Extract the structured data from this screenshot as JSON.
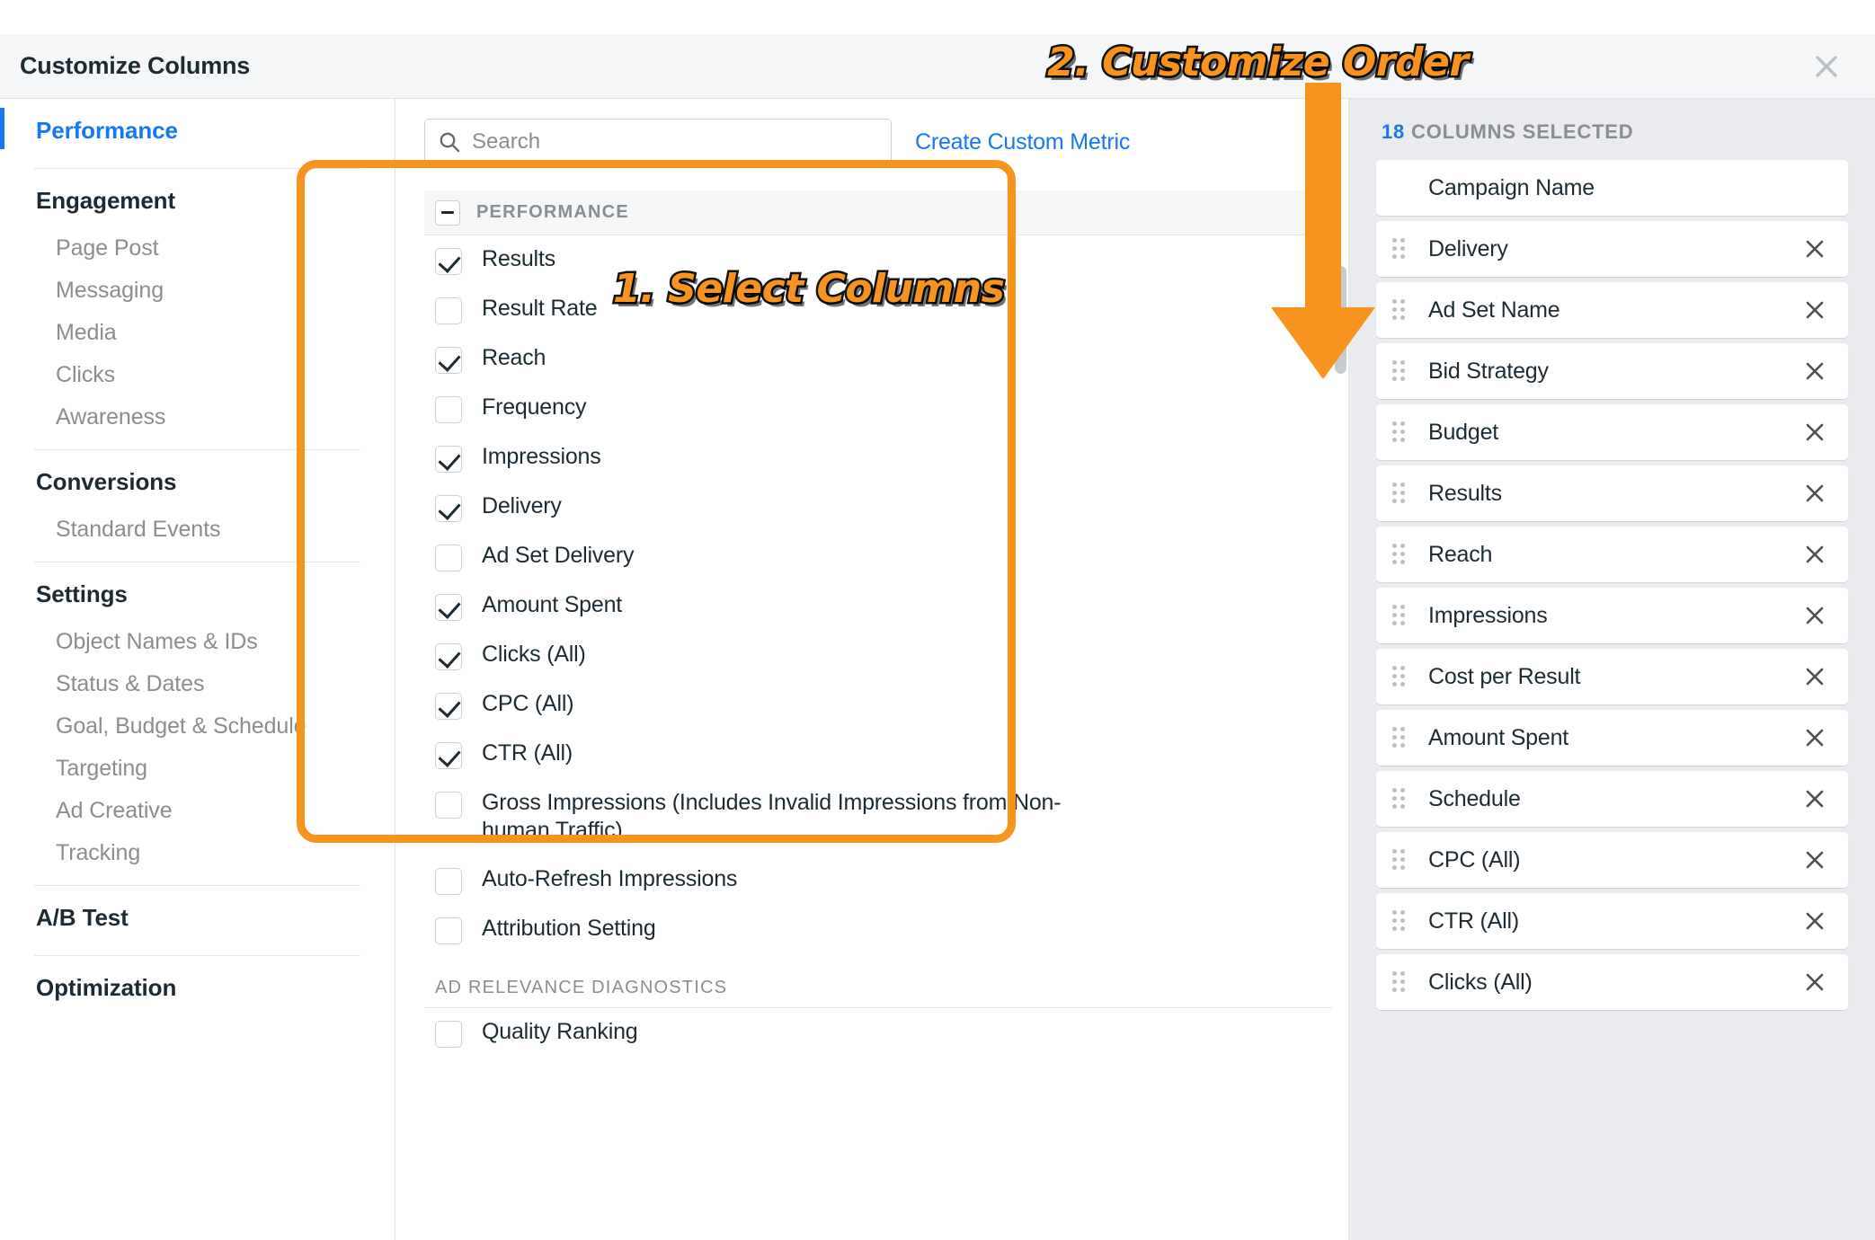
{
  "dialog": {
    "title": "Customize Columns",
    "close_icon": "close-icon"
  },
  "annotations": {
    "step1": "1. Select Columns",
    "step2": "2. Customize Order",
    "accent_color": "#F7931E",
    "outline_color": "#111111"
  },
  "sidebar": {
    "groups": [
      {
        "head": "Performance",
        "active": true,
        "items": []
      },
      {
        "head": "Engagement",
        "active": false,
        "items": [
          "Page Post",
          "Messaging",
          "Media",
          "Clicks",
          "Awareness"
        ]
      },
      {
        "head": "Conversions",
        "active": false,
        "items": [
          "Standard Events"
        ]
      },
      {
        "head": "Settings",
        "active": false,
        "items": [
          "Object Names & IDs",
          "Status & Dates",
          "Goal, Budget & Schedule",
          "Targeting",
          "Ad Creative",
          "Tracking"
        ]
      },
      {
        "head": "A/B Test",
        "active": false,
        "items": []
      },
      {
        "head": "Optimization",
        "active": false,
        "items": []
      }
    ]
  },
  "search": {
    "placeholder": "Search",
    "value": "",
    "icon": "search-icon"
  },
  "create_custom_metric_label": "Create Custom Metric",
  "sections": [
    {
      "title": "PERFORMANCE",
      "collapsed": false,
      "options": [
        {
          "label": "Results",
          "checked": true
        },
        {
          "label": "Result Rate",
          "checked": false
        },
        {
          "label": "Reach",
          "checked": true
        },
        {
          "label": "Frequency",
          "checked": false
        },
        {
          "label": "Impressions",
          "checked": true
        },
        {
          "label": "Delivery",
          "checked": true
        },
        {
          "label": "Ad Set Delivery",
          "checked": false
        },
        {
          "label": "Amount Spent",
          "checked": true
        },
        {
          "label": "Clicks (All)",
          "checked": true
        },
        {
          "label": "CPC (All)",
          "checked": true
        },
        {
          "label": "CTR (All)",
          "checked": true
        },
        {
          "label": "Gross Impressions (Includes Invalid Impressions from Non-human Traffic)",
          "checked": false
        },
        {
          "label": "Auto-Refresh Impressions",
          "checked": false
        },
        {
          "label": "Attribution Setting",
          "checked": false
        }
      ]
    },
    {
      "title": "AD RELEVANCE DIAGNOSTICS",
      "collapsed": false,
      "options": [
        {
          "label": "Quality Ranking",
          "checked": false
        }
      ]
    }
  ],
  "selected_panel": {
    "count": "18",
    "count_label": "COLUMNS SELECTED",
    "columns": [
      {
        "label": "Campaign Name",
        "draggable": false,
        "removable": false
      },
      {
        "label": "Delivery",
        "draggable": true,
        "removable": true
      },
      {
        "label": "Ad Set Name",
        "draggable": true,
        "removable": true
      },
      {
        "label": "Bid Strategy",
        "draggable": true,
        "removable": true
      },
      {
        "label": "Budget",
        "draggable": true,
        "removable": true
      },
      {
        "label": "Results",
        "draggable": true,
        "removable": true
      },
      {
        "label": "Reach",
        "draggable": true,
        "removable": true
      },
      {
        "label": "Impressions",
        "draggable": true,
        "removable": true
      },
      {
        "label": "Cost per Result",
        "draggable": true,
        "removable": true
      },
      {
        "label": "Amount Spent",
        "draggable": true,
        "removable": true
      },
      {
        "label": "Schedule",
        "draggable": true,
        "removable": true
      },
      {
        "label": "CPC (All)",
        "draggable": true,
        "removable": true
      },
      {
        "label": "CTR (All)",
        "draggable": true,
        "removable": true
      },
      {
        "label": "Clicks (All)",
        "draggable": true,
        "removable": true
      }
    ]
  }
}
